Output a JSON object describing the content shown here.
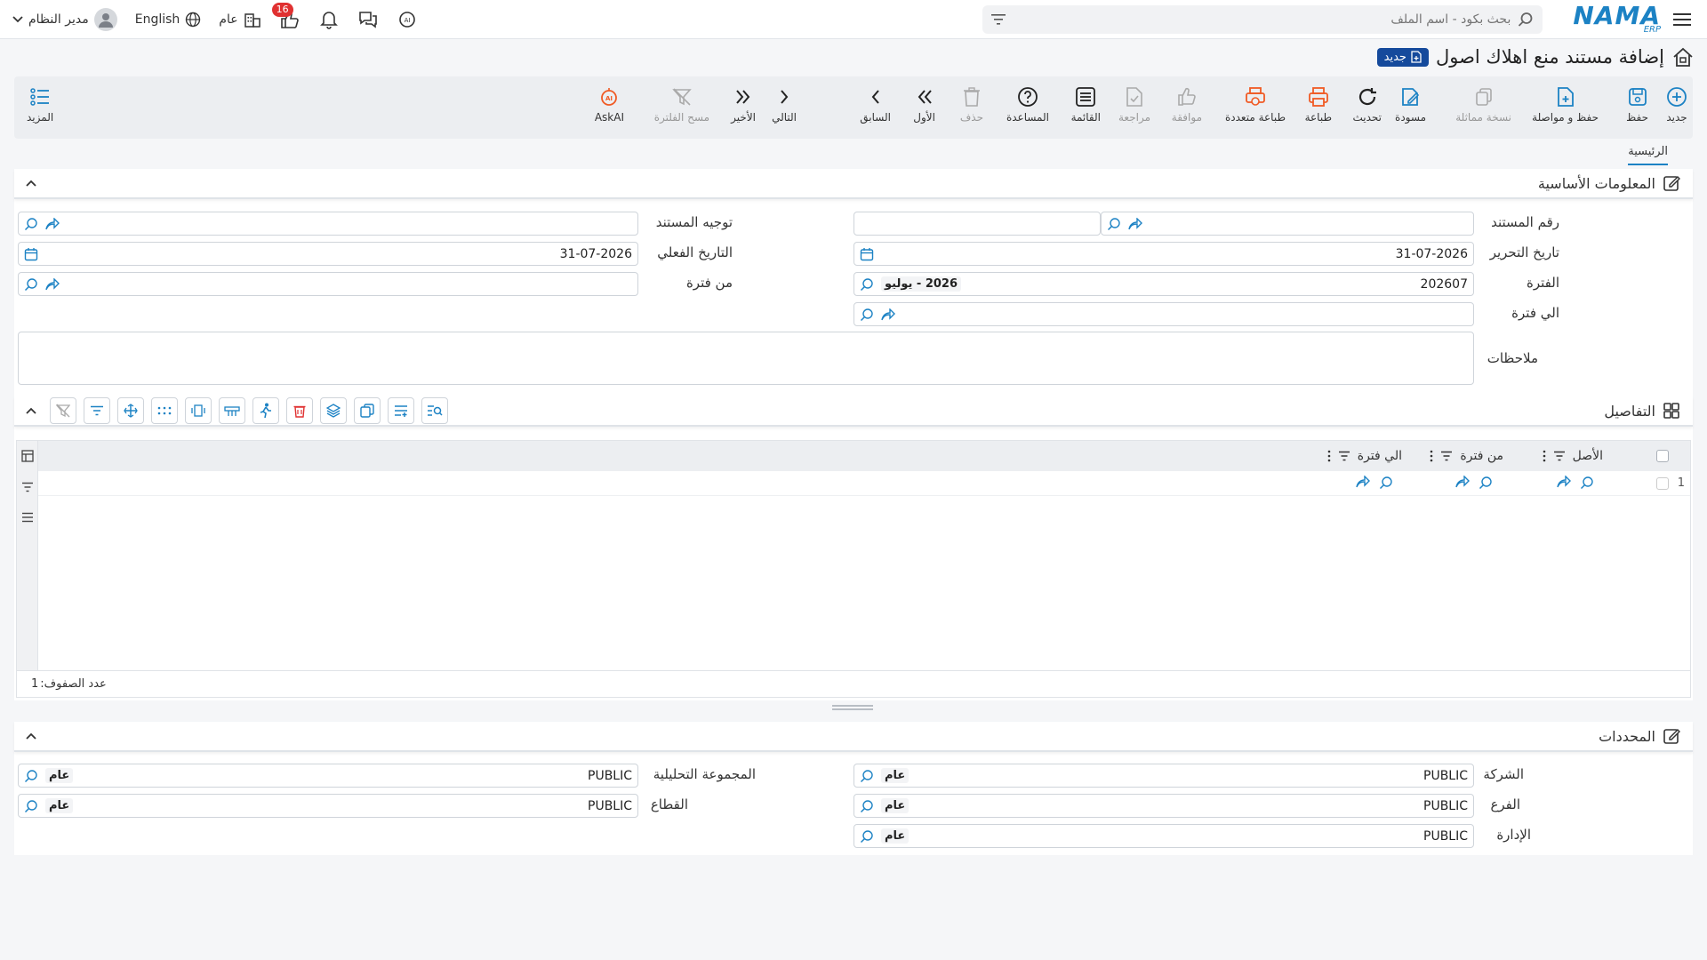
{
  "topbar": {
    "logo_main": "NAMA",
    "logo_sub": "ERP",
    "search_placeholder": "بحث بكود - اسم الملف",
    "notification_count": "16",
    "public_label": "عام",
    "language_label": "English",
    "user_name": "مدير النظام"
  },
  "page": {
    "title": "إضافة مستند منع اهلاك اصول",
    "status_badge": "جديد"
  },
  "toolbar": {
    "new": "جديد",
    "save": "حفظ",
    "save_continue": "حفظ و مواصلة",
    "copy": "نسخة مماثلة",
    "draft": "مسودة",
    "refresh": "تحديث",
    "print": "طباعة",
    "multi_print": "طباعة متعددة",
    "approve": "موافقة",
    "review": "مراجعة",
    "list": "القائمة",
    "help": "المساعدة",
    "delete": "حذف",
    "first": "الأول",
    "prev": "السابق",
    "next": "التالي",
    "last": "الأخير",
    "clear_filter": "مسح الفلترة",
    "askai": "AskAI",
    "more": "المزيد"
  },
  "tabs": {
    "main": "الرئيسية"
  },
  "basic_info": {
    "title": "المعلومات الأساسية",
    "doc_number_label": "رقم المستند",
    "doc_number_value": "",
    "doc_direction_label": "توجيه المستند",
    "doc_direction_value": "",
    "edit_date_label": "تاريخ التحرير",
    "edit_date_value": "31-07-2026",
    "actual_date_label": "التاريخ الفعلي",
    "actual_date_value": "31-07-2026",
    "period_label": "الفترة",
    "period_value": "202607",
    "period_name": "2026 - يوليو",
    "from_period_label": "من فترة",
    "from_period_value": "",
    "to_period_label": "الي فترة",
    "to_period_value": "",
    "notes_label": "ملاحظات",
    "notes_value": ""
  },
  "details": {
    "title": "التفاصيل",
    "columns": [
      "الأصل",
      "من فترة",
      "الي فترة"
    ],
    "rows": [
      {
        "num": "1",
        "asset": "",
        "from": "",
        "to": ""
      }
    ],
    "row_count_label": "عدد الصفوف:",
    "row_count": "1"
  },
  "dimensions": {
    "title": "المحددات",
    "company_label": "الشركة",
    "company_code": "PUBLIC",
    "company_name": "عام",
    "branch_label": "الفرع",
    "branch_code": "PUBLIC",
    "branch_name": "عام",
    "department_label": "الإدارة",
    "department_code": "PUBLIC",
    "department_name": "عام",
    "analytic_group_label": "المجموعة التحليلية",
    "analytic_group_code": "PUBLIC",
    "analytic_group_name": "عام",
    "sector_label": "القطاع",
    "sector_code": "PUBLIC",
    "sector_name": "عام"
  },
  "colors": {
    "accent": "#1c82c4",
    "danger": "#e03131",
    "print_orange": "#f05a24",
    "badge_navy": "#154a9c"
  }
}
